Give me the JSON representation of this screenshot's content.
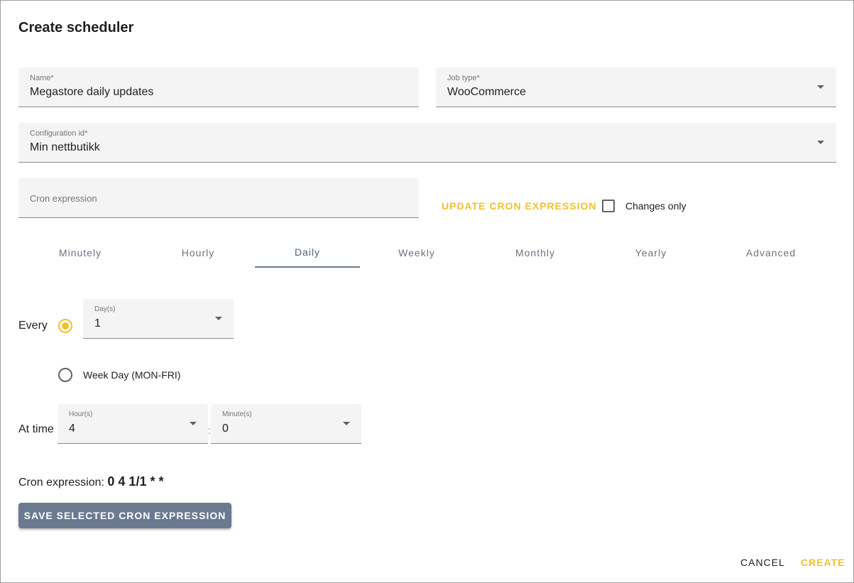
{
  "dialog": {
    "title": "Create scheduler"
  },
  "form": {
    "name": {
      "label": "Name",
      "required": "*",
      "value": "Megastore daily updates"
    },
    "job_type": {
      "label": "Job type",
      "required": "*",
      "value": "WooCommerce"
    },
    "configuration_id": {
      "label": "Configuration id",
      "required": "*",
      "value": "Min nettbutikk"
    },
    "cron_expression": {
      "placeholder": "Cron expression"
    },
    "update_cron_label": "UPDATE CRON EXPRESSION",
    "changes_only": {
      "label": "Changes only",
      "checked": false
    }
  },
  "tabs": [
    {
      "label": "Minutely",
      "active": false
    },
    {
      "label": "Hourly",
      "active": false
    },
    {
      "label": "Daily",
      "active": true
    },
    {
      "label": "Weekly",
      "active": false
    },
    {
      "label": "Monthly",
      "active": false
    },
    {
      "label": "Yearly",
      "active": false
    },
    {
      "label": "Advanced",
      "active": false
    }
  ],
  "daily": {
    "every_label": "Every",
    "days": {
      "label": "Day(s)",
      "value": "1"
    },
    "weekday_label": "Week Day (MON-FRI)",
    "selected_option": "every",
    "at_time_label": "At time",
    "hours": {
      "label": "Hour(s)",
      "value": "4"
    },
    "time_separator": ":",
    "minutes": {
      "label": "Minute(s)",
      "value": "0"
    }
  },
  "cron_result": {
    "label": "Cron expression:",
    "value": "0 4 1/1 * *"
  },
  "save_cron_label": "SAVE SELECTED CRON EXPRESSION",
  "footer": {
    "cancel_label": "CANCEL",
    "create_label": "CREATE"
  },
  "colors": {
    "accent": "#f2c12e",
    "primary": "#6b7a90",
    "field_bg": "#f4f4f4"
  }
}
